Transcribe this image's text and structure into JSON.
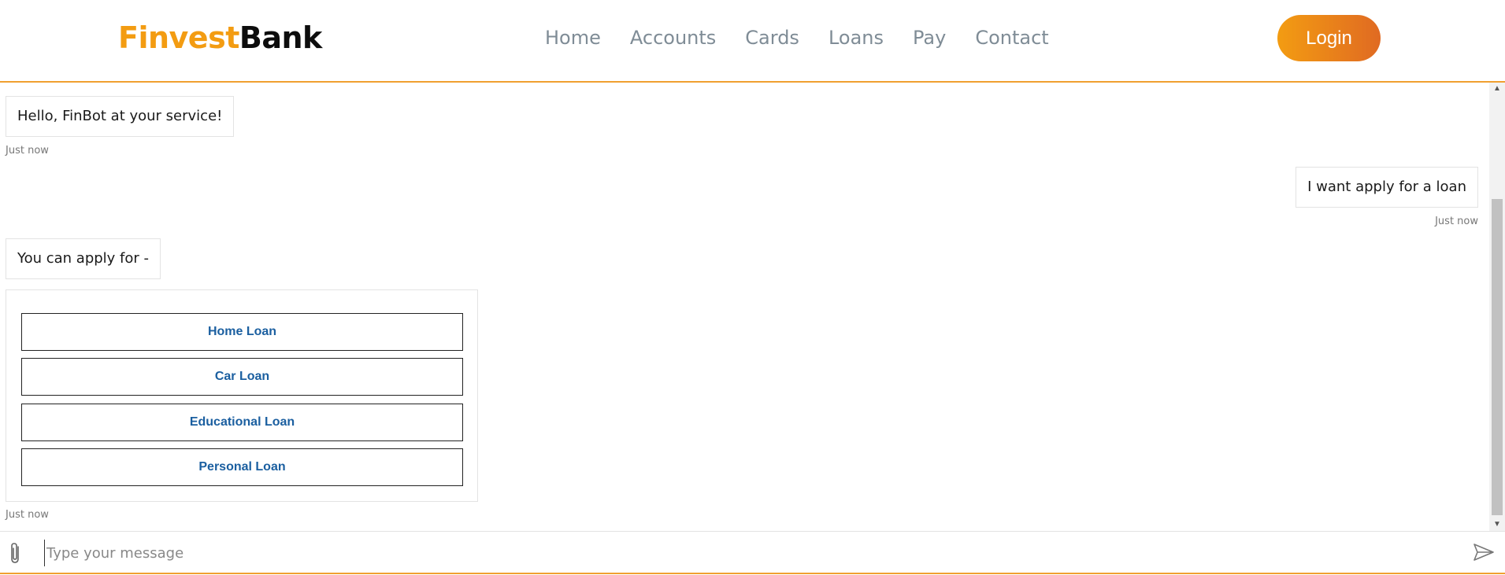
{
  "header": {
    "logo_part1": "Finvest",
    "logo_part2": "Bank",
    "nav": [
      "Home",
      "Accounts",
      "Cards",
      "Loans",
      "Pay",
      "Contact"
    ],
    "login_label": "Login",
    "accent_color": "#f39c12"
  },
  "chat": {
    "messages": [
      {
        "from": "bot",
        "text": "Hello, FinBot at your service!",
        "time": "Just now"
      },
      {
        "from": "user",
        "text": "I want apply for a loan",
        "time": "Just now"
      },
      {
        "from": "bot",
        "text": "You can apply for -"
      }
    ],
    "options": [
      "Home Loan",
      "Car Loan",
      "Educational Loan",
      "Personal Loan"
    ],
    "options_time": "Just now",
    "option_text_color": "#1b5fa0"
  },
  "composer": {
    "placeholder": "Type your message",
    "value": "",
    "attach_icon": "paperclip-icon",
    "send_icon": "send-icon"
  }
}
